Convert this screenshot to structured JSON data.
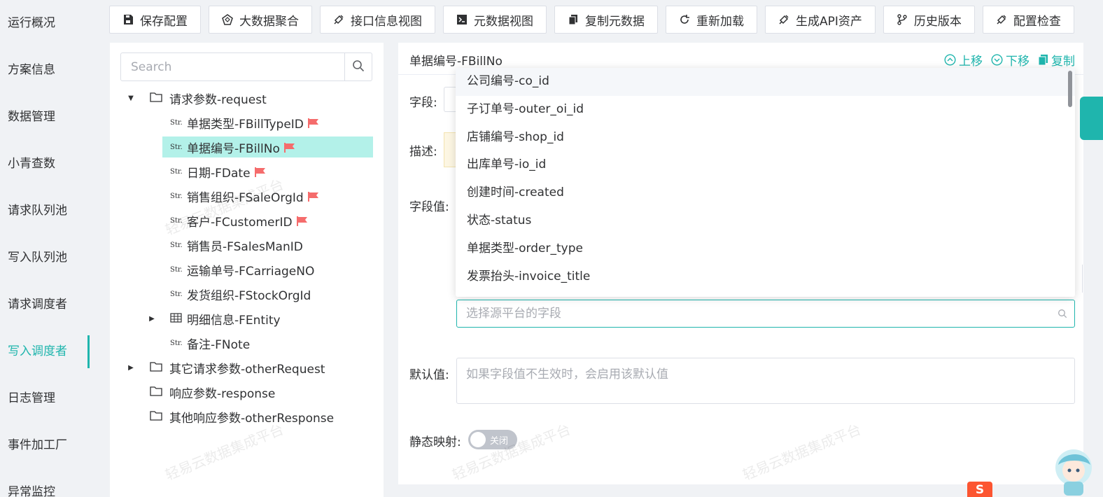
{
  "nav": {
    "items": [
      {
        "label": "运行概况"
      },
      {
        "label": "方案信息"
      },
      {
        "label": "数据管理"
      },
      {
        "label": "小青查数"
      },
      {
        "label": "请求队列池"
      },
      {
        "label": "写入队列池"
      },
      {
        "label": "请求调度者"
      },
      {
        "label": "写入调度者",
        "active": true
      },
      {
        "label": "日志管理"
      },
      {
        "label": "事件加工厂"
      },
      {
        "label": "异常监控"
      }
    ]
  },
  "toolbar": {
    "buttons": [
      {
        "label": "保存配置",
        "icon": "save-icon"
      },
      {
        "label": "大数据聚合",
        "icon": "aggregate-icon"
      },
      {
        "label": "接口信息视图",
        "icon": "link-icon"
      },
      {
        "label": "元数据视图",
        "icon": "terminal-icon"
      },
      {
        "label": "复制元数据",
        "icon": "copy-icon"
      },
      {
        "label": "重新加载",
        "icon": "reload-icon"
      },
      {
        "label": "生成API资产",
        "icon": "link-icon"
      },
      {
        "label": "历史版本",
        "icon": "branch-icon"
      },
      {
        "label": "配置检查",
        "icon": "link-icon"
      }
    ]
  },
  "tree_search": {
    "placeholder": "Search"
  },
  "tree": {
    "request": "请求参数-request",
    "children": [
      {
        "label": "单据类型-FBillTypeID",
        "flag": true
      },
      {
        "label": "单据编号-FBillNo",
        "flag": true,
        "selected": true
      },
      {
        "label": "日期-FDate",
        "flag": true
      },
      {
        "label": "销售组织-FSaleOrgId",
        "flag": true
      },
      {
        "label": "客户-FCustomerID",
        "flag": true
      },
      {
        "label": "销售员-FSalesManID",
        "flag": false
      },
      {
        "label": "运输单号-FCarriageNO",
        "flag": false
      },
      {
        "label": "发货组织-FStockOrgId",
        "flag": false
      }
    ],
    "entity": "明细信息-FEntity",
    "note": "备注-FNote",
    "other_request": "其它请求参数-otherRequest",
    "response": "响应参数-response",
    "other_response": "其他响应参数-otherResponse",
    "str_tag": "Str."
  },
  "detail": {
    "title": "单据编号-FBillNo",
    "actions": {
      "up": "上移",
      "down": "下移",
      "copy": "复制"
    },
    "field_label": "字段:",
    "desc_label": "描述:",
    "value_label": "字段值:",
    "default_label": "默认值:",
    "default_placeholder": "如果字段值不生效时，会启用该默认值",
    "static_label": "静态映射:",
    "toggle_text": "关闭",
    "source_placeholder": "选择源平台的字段"
  },
  "dropdown": {
    "options": [
      "公司编号-co_id",
      "子订单号-outer_oi_id",
      "店铺编号-shop_id",
      "出库单号-io_id",
      "创建时间-created",
      "状态-status",
      "单据类型-order_type",
      "发票抬头-invoice_title"
    ]
  },
  "watermark": "轻易云数据集成平台",
  "csdn_logo": "S",
  "colors": {
    "accent": "#1fb5ad",
    "flag": "#f56c6c",
    "selected_bg": "#b3f1e9"
  }
}
